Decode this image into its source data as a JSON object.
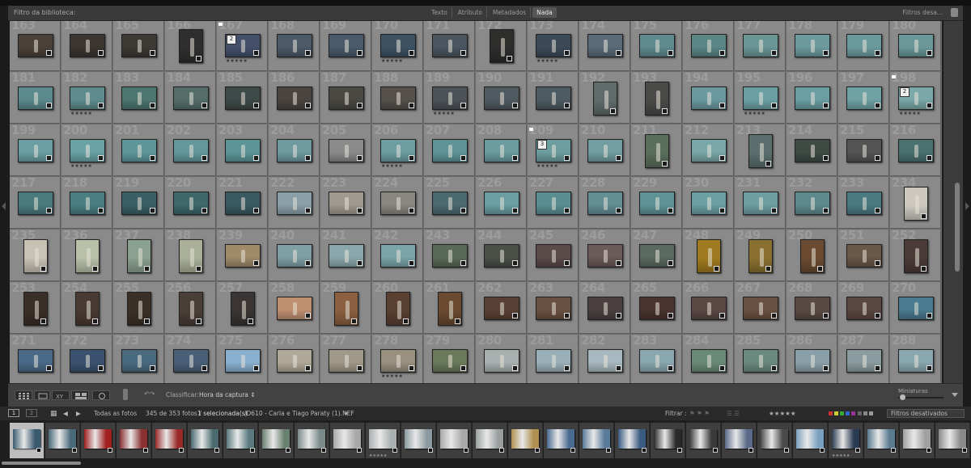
{
  "library_filter": {
    "title": "Filtro da biblioteca:",
    "tabs": [
      "Texto",
      "Atributo",
      "Metadados",
      "Nada"
    ],
    "active_tab": "Nada",
    "filters_preset": "Filtros desa..."
  },
  "grid": {
    "columns": 18,
    "start_number": 163,
    "rows": [
      {
        "numbers": [
          "163",
          "164",
          "165",
          "166",
          "167",
          "168",
          "169",
          "170",
          "171",
          "172",
          "173",
          "174",
          "175",
          "176",
          "177",
          "178",
          "179",
          "180"
        ],
        "colors": [
          "#4a4038",
          "#3b3530",
          "#3d3a35",
          "#2f2e2e",
          "#44506a",
          "#4c5a68",
          "#4a5a6a",
          "#3e5262",
          "#4a5560",
          "#2d2d2c",
          "#3c4a58",
          "#5a6a78",
          "#5f8a8f",
          "#5b8686",
          "#6a9696",
          "#6c9a9e",
          "#6b9a9e",
          "#6a9898"
        ],
        "portrait": [
          false,
          false,
          false,
          true,
          false,
          false,
          false,
          false,
          false,
          true,
          false,
          false,
          false,
          false,
          false,
          false,
          false,
          false
        ],
        "stars": [
          false,
          false,
          false,
          false,
          true,
          false,
          false,
          true,
          false,
          false,
          true,
          false,
          false,
          false,
          false,
          false,
          false,
          false
        ],
        "stack": [
          "",
          "",
          "",
          "",
          "2",
          "",
          "",
          "",
          "",
          "",
          "",
          "",
          "",
          "",
          "",
          "",
          "",
          ""
        ]
      },
      {
        "numbers": [
          "181",
          "182",
          "183",
          "184",
          "185",
          "186",
          "187",
          "188",
          "189",
          "190",
          "191",
          "192",
          "193",
          "194",
          "195",
          "196",
          "197",
          "198"
        ],
        "colors": [
          "#5b8a8e",
          "#5e8c8e",
          "#4d7670",
          "#556e6a",
          "#3e4a48",
          "#4a4440",
          "#4a4842",
          "#55504a",
          "#4d5258",
          "#4f5a60",
          "#4d5a62",
          "#606a6a",
          "#4a4a48",
          "#6a9aa0",
          "#6aa0a4",
          "#6a9ea2",
          "#6ea2a4",
          "#7aa8a8"
        ],
        "portrait": [
          false,
          false,
          false,
          false,
          false,
          false,
          false,
          false,
          false,
          false,
          false,
          true,
          true,
          false,
          false,
          false,
          false,
          false
        ],
        "stars": [
          false,
          true,
          false,
          false,
          false,
          false,
          false,
          false,
          true,
          false,
          false,
          false,
          false,
          false,
          true,
          false,
          false,
          true
        ],
        "stack": [
          "",
          "",
          "",
          "",
          "",
          "",
          "",
          "",
          "",
          "",
          "",
          "",
          "",
          "",
          "",
          "",
          "",
          "2"
        ]
      },
      {
        "numbers": [
          "199",
          "200",
          "201",
          "202",
          "203",
          "204",
          "205",
          "206",
          "207",
          "208",
          "209",
          "210",
          "211",
          "212",
          "213",
          "214",
          "215",
          "216"
        ],
        "colors": [
          "#6a9ea4",
          "#6aa2a6",
          "#5e969c",
          "#64989c",
          "#5c9498",
          "#6e9aa0",
          "#8a8a8a",
          "#6c9ea2",
          "#5e9498",
          "#6a9ca0",
          "#6c9ea0",
          "#729ea2",
          "#5a6e5c",
          "#7aa8a8",
          "#5a6e6e",
          "#3e4a44",
          "#545454",
          "#4a7070"
        ],
        "portrait": [
          false,
          false,
          false,
          false,
          false,
          false,
          false,
          false,
          false,
          false,
          false,
          false,
          true,
          false,
          true,
          false,
          false,
          false
        ],
        "stars": [
          false,
          true,
          false,
          false,
          false,
          false,
          false,
          true,
          false,
          false,
          true,
          false,
          false,
          false,
          false,
          false,
          false,
          false
        ],
        "stack": [
          "",
          "",
          "",
          "",
          "",
          "",
          "",
          "",
          "",
          "",
          "3",
          "",
          "",
          "",
          "",
          "",
          "",
          ""
        ]
      },
      {
        "numbers": [
          "217",
          "218",
          "219",
          "220",
          "221",
          "222",
          "223",
          "224",
          "225",
          "226",
          "227",
          "228",
          "229",
          "230",
          "231",
          "232",
          "233",
          "234"
        ],
        "colors": [
          "#4a7a7e",
          "#4a7e82",
          "#3a6066",
          "#3e686a",
          "#3a5a62",
          "#8aa0a8",
          "#a09a90",
          "#8a8680",
          "#4a6a70",
          "#6a9ea2",
          "#5a8e92",
          "#628e94",
          "#5e9296",
          "#6aa0a4",
          "#6e9ea2",
          "#5e8a8e",
          "#4a7a82",
          "#ccc8c0"
        ],
        "portrait": [
          false,
          false,
          false,
          false,
          false,
          false,
          false,
          false,
          false,
          false,
          false,
          false,
          false,
          false,
          false,
          false,
          false,
          true
        ],
        "stars": [
          false,
          false,
          false,
          false,
          false,
          false,
          false,
          false,
          false,
          false,
          false,
          false,
          false,
          false,
          false,
          false,
          false,
          false
        ],
        "stack": [
          "",
          "",
          "",
          "",
          "",
          "",
          "",
          "",
          "",
          "",
          "",
          "",
          "",
          "",
          "",
          "",
          "",
          ""
        ]
      },
      {
        "numbers": [
          "235",
          "236",
          "237",
          "238",
          "239",
          "240",
          "241",
          "242",
          "243",
          "244",
          "245",
          "246",
          "247",
          "248",
          "249",
          "250",
          "251",
          "252"
        ],
        "colors": [
          "#c8c2b4",
          "#b8c0a8",
          "#8aa090",
          "#aab098",
          "#a08a6a",
          "#7ea0a4",
          "#8aa8ac",
          "#7aa4a8",
          "#5a6a58",
          "#4a5048",
          "#5a4a4a",
          "#6a5a58",
          "#5a6a60",
          "#a07a20",
          "#8a7030",
          "#6a4a30",
          "#6a5848",
          "#4a3a38"
        ],
        "portrait": [
          true,
          true,
          true,
          true,
          false,
          false,
          false,
          false,
          false,
          false,
          false,
          false,
          false,
          true,
          true,
          true,
          false,
          true
        ],
        "stars": [
          false,
          false,
          false,
          false,
          false,
          false,
          false,
          false,
          false,
          false,
          false,
          false,
          false,
          false,
          false,
          false,
          false,
          false
        ],
        "stack": [
          "",
          "",
          "",
          "",
          "",
          "",
          "",
          "",
          "",
          "",
          "",
          "",
          "",
          "",
          "",
          "",
          "",
          ""
        ]
      },
      {
        "numbers": [
          "253",
          "254",
          "255",
          "256",
          "257",
          "258",
          "259",
          "260",
          "261",
          "262",
          "263",
          "264",
          "265",
          "266",
          "267",
          "268",
          "269",
          "270"
        ],
        "colors": [
          "#3a2e28",
          "#4a3a34",
          "#3a3028",
          "#4a3e38",
          "#3a3434",
          "#c09070",
          "#8a6040",
          "#5a4030",
          "#6a4a30",
          "#5a4034",
          "#6a5040",
          "#4a4040",
          "#4a3430",
          "#5a4844",
          "#6a5040",
          "#5a4a44",
          "#5a4640",
          "#4a7a90"
        ],
        "portrait": [
          true,
          true,
          true,
          true,
          true,
          false,
          true,
          true,
          true,
          false,
          false,
          false,
          false,
          false,
          false,
          false,
          false,
          false
        ],
        "stars": [
          false,
          false,
          false,
          false,
          false,
          false,
          false,
          false,
          false,
          false,
          false,
          false,
          false,
          false,
          false,
          false,
          false,
          false
        ],
        "stack": [
          "",
          "",
          "",
          "",
          "",
          "",
          "",
          "",
          "",
          "",
          "",
          "",
          "",
          "",
          "",
          "",
          "",
          ""
        ]
      },
      {
        "numbers": [
          "271",
          "272",
          "273",
          "274",
          "275",
          "276",
          "277",
          "278",
          "279",
          "280",
          "281",
          "282",
          "283",
          "284",
          "285",
          "286",
          "287",
          "288"
        ],
        "colors": [
          "#4a6a88",
          "#3a5270",
          "#4a6a80",
          "#4a6078",
          "#8ab0d0",
          "#b0a898",
          "#a09888",
          "#9a9080",
          "#6a7a5a",
          "#a8b0b0",
          "#9ab0b8",
          "#a8b8c0",
          "#8aa8b0",
          "#6a8a78",
          "#6a8a80",
          "#8aa0a8",
          "#8a9ca0",
          "#8aa8b0"
        ],
        "portrait": [
          false,
          false,
          false,
          false,
          false,
          false,
          false,
          false,
          false,
          false,
          false,
          false,
          false,
          false,
          false,
          false,
          false,
          false
        ],
        "stars": [
          false,
          false,
          false,
          false,
          false,
          false,
          false,
          true,
          false,
          false,
          false,
          false,
          false,
          false,
          false,
          false,
          false,
          false
        ],
        "stack": [
          "",
          "",
          "",
          "",
          "",
          "",
          "",
          "",
          "",
          "",
          "",
          "",
          "",
          "",
          "",
          "",
          "",
          ""
        ]
      }
    ]
  },
  "toolbar": {
    "sort_label": "Classificar:",
    "sort_value": "Hora da captura",
    "thumbnails_label": "Miniaturas"
  },
  "filmstrip_bar": {
    "monitor1": "1",
    "monitor2": "2",
    "source": "Todas as fotos",
    "count": "345 de 353 fotos /",
    "selected": "1 selecionada(s)",
    "filename": "/D610 - Carla e Tiago Paraty (1).NEF",
    "filter_label": "Filtrar :",
    "stars": "★★★★★",
    "filters_off": "Filtros desativados"
  },
  "filmstrip": {
    "colors": [
      "#3a5a70",
      "#4a6a7a",
      "#a02020",
      "#8a3030",
      "#9a2a2a",
      "#4a6a70",
      "#5a7a80",
      "#6a8070",
      "#7a8a8a",
      "#a8a8a8",
      "#aab0b0",
      "#8a9aa0",
      "#a8a8a8",
      "#9aa0a0",
      "#b09050",
      "#4a6a90",
      "#5a7a9a",
      "#3a5a80",
      "#2a2a2a",
      "#3a3a3a",
      "#5a6a88",
      "#4a4a4a",
      "#7aa0c0",
      "#2a3a50",
      "#5a7a90",
      "#a0a0a0",
      "#8a8a8a"
    ],
    "selected_index": 0,
    "star_indices": [
      10,
      23
    ]
  }
}
